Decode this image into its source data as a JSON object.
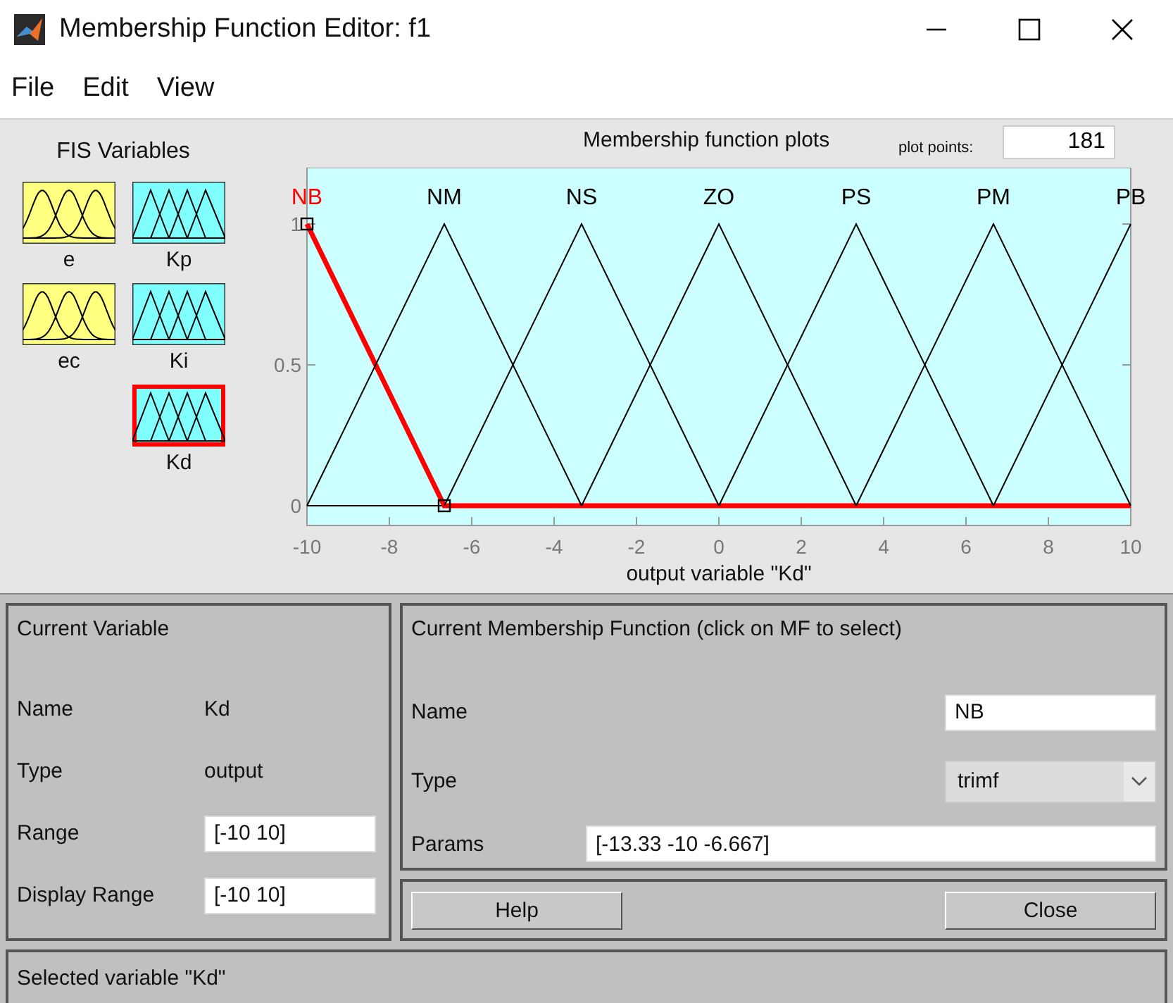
{
  "window": {
    "title": "Membership Function Editor: f1"
  },
  "menu": [
    "File",
    "Edit",
    "View"
  ],
  "fis_variables": {
    "title": "FIS Variables",
    "items": [
      {
        "name": "e",
        "kind": "input",
        "selected": false
      },
      {
        "name": "ec",
        "kind": "input",
        "selected": false
      },
      {
        "name": "Kp",
        "kind": "output",
        "selected": false
      },
      {
        "name": "Ki",
        "kind": "output",
        "selected": false
      },
      {
        "name": "Kd",
        "kind": "output",
        "selected": true
      }
    ]
  },
  "plot": {
    "title": "Membership function plots",
    "plot_points_label": "plot points:",
    "plot_points": "181",
    "chart_data": {
      "type": "line",
      "xlabel": "output variable \"Kd\"",
      "x": [
        -10,
        -6.667,
        -3.333,
        0,
        3.333,
        6.667,
        10
      ],
      "xlim": [
        -10,
        10
      ],
      "ylim": [
        -0.07,
        1.2
      ],
      "xticks": [
        -10,
        -8,
        -6,
        -4,
        -2,
        0,
        2,
        4,
        6,
        8,
        10
      ],
      "yticks": [
        0,
        0.5,
        1
      ],
      "series": [
        {
          "name": "NB",
          "color": "#ff0000",
          "values": [
            1,
            0,
            0,
            0,
            0,
            0,
            0
          ]
        },
        {
          "name": "NM",
          "color": "#000000",
          "values": [
            0,
            1,
            0,
            null,
            null,
            null,
            null
          ]
        },
        {
          "name": "NS",
          "color": "#000000",
          "values": [
            null,
            0,
            1,
            0,
            null,
            null,
            null
          ]
        },
        {
          "name": "ZO",
          "color": "#000000",
          "values": [
            null,
            null,
            0,
            1,
            0,
            null,
            null
          ]
        },
        {
          "name": "PS",
          "color": "#000000",
          "values": [
            null,
            null,
            null,
            0,
            1,
            0,
            null
          ]
        },
        {
          "name": "PM",
          "color": "#000000",
          "values": [
            null,
            null,
            null,
            null,
            0,
            1,
            0
          ]
        },
        {
          "name": "PB",
          "color": "#000000",
          "values": [
            null,
            null,
            null,
            null,
            null,
            0,
            1
          ]
        }
      ],
      "legend": "top"
    },
    "mf_selection": [
      {
        "selected": true
      },
      {
        "selected": false
      },
      {
        "selected": false
      },
      {
        "selected": false
      },
      {
        "selected": false
      },
      {
        "selected": false
      },
      {
        "selected": false
      }
    ]
  },
  "current_variable": {
    "title": "Current Variable",
    "name_label": "Name",
    "name": "Kd",
    "type_label": "Type",
    "type": "output",
    "range_label": "Range",
    "range": "[-10 10]",
    "display_range_label": "Display Range",
    "display_range": "[-10 10]"
  },
  "current_mf": {
    "title": "Current Membership Function (click on MF to select)",
    "name_label": "Name",
    "name": "NB",
    "type_label": "Type",
    "type": "trimf",
    "params_label": "Params",
    "params": "[-13.33 -10 -6.667]"
  },
  "buttons": [
    "Help",
    "Close"
  ],
  "status": "Selected variable \"Kd\""
}
